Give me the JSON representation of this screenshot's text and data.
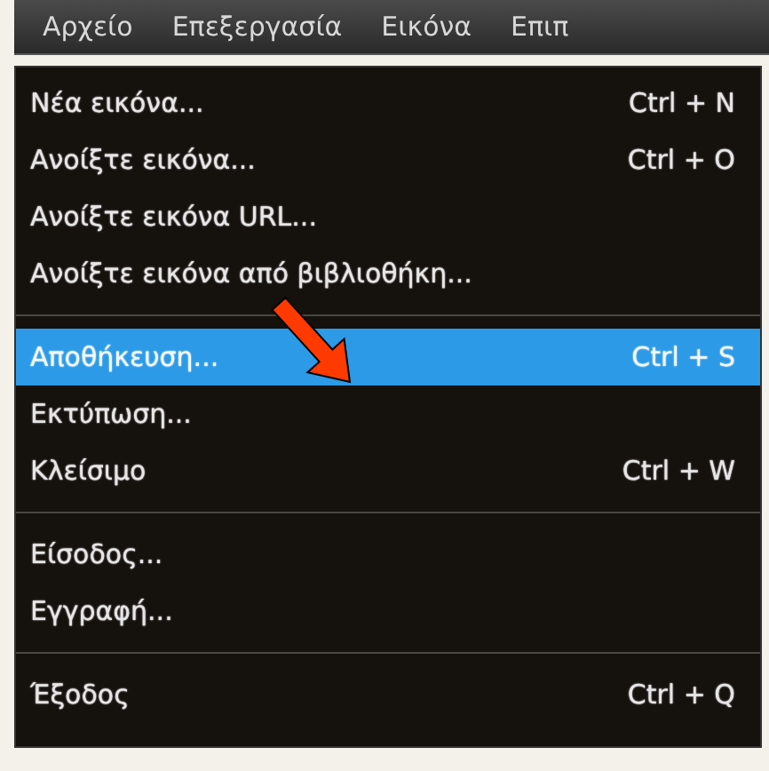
{
  "menu_bar": {
    "items": [
      "Αρχείο",
      "Επεξεργασία",
      "Εικόνα",
      "Επιπ"
    ]
  },
  "file_menu": {
    "groups": [
      {
        "items": [
          {
            "label": "Νέα εικόνα...",
            "shortcut": "Ctrl + N",
            "selected": false
          },
          {
            "label": "Ανοίξτε εικόνα...",
            "shortcut": "Ctrl + O",
            "selected": false
          },
          {
            "label": "Ανοίξτε εικόνα URL...",
            "selected": false
          },
          {
            "label": "Ανοίξτε εικόνα από βιβλιοθήκη...",
            "selected": false
          }
        ]
      },
      {
        "items": [
          {
            "label": "Αποθήκευση...",
            "shortcut": "Ctrl + S",
            "selected": true
          },
          {
            "label": "Εκτύπωση...",
            "selected": false
          },
          {
            "label": "Κλείσιμο",
            "shortcut": "Ctrl + W",
            "selected": false
          }
        ]
      },
      {
        "items": [
          {
            "label": "Είσοδος...",
            "selected": false
          },
          {
            "label": "Εγγραφή...",
            "selected": false
          }
        ]
      },
      {
        "items": [
          {
            "label": "Έξοδος",
            "shortcut": "Ctrl + Q",
            "selected": false
          }
        ]
      }
    ]
  }
}
